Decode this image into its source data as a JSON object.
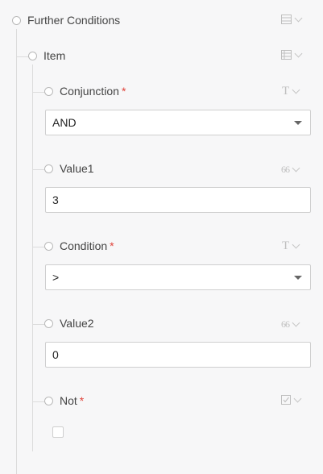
{
  "groups": {
    "further_conditions": {
      "label": "Further Conditions",
      "icon": "list-icon"
    },
    "item": {
      "label": "Item",
      "icon": "table-icon"
    }
  },
  "fields": {
    "conjunction": {
      "label": "Conjunction",
      "required": "*",
      "icon": "text-type-icon",
      "value": "AND"
    },
    "value1": {
      "label": "Value1",
      "icon": "quote-icon",
      "value": "3"
    },
    "condition": {
      "label": "Condition",
      "required": "*",
      "icon": "text-type-icon",
      "value": ">"
    },
    "value2": {
      "label": "Value2",
      "icon": "quote-icon",
      "value": "0"
    },
    "not": {
      "label": "Not",
      "required": "*",
      "icon": "checkbox-icon",
      "checked": false
    }
  },
  "colors": {
    "background": "#f7f7f8",
    "required": "#e0433a",
    "border": "#cfcfcf"
  }
}
